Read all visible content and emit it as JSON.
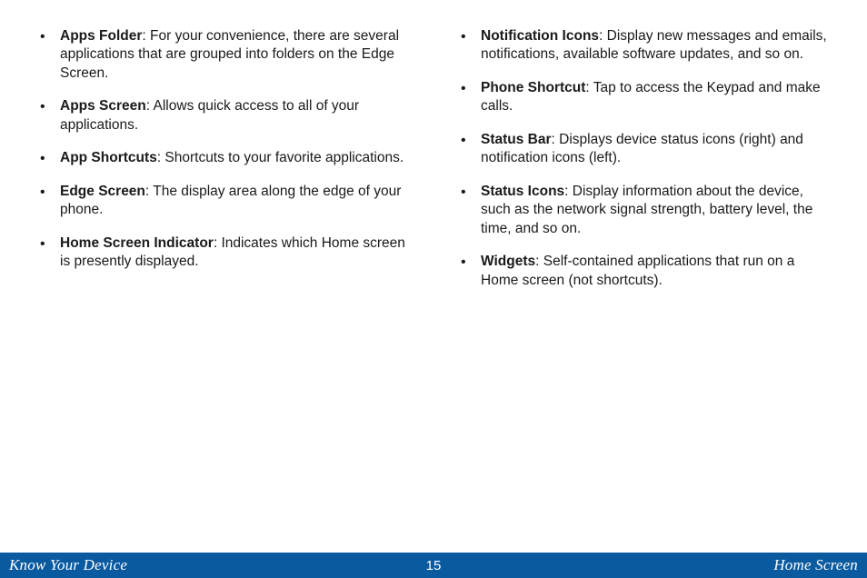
{
  "left_items": [
    {
      "term": "Apps Folder",
      "desc": ": For your convenience, there are several applications that are grouped into folders on the Edge Screen."
    },
    {
      "term": "Apps Screen",
      "desc": ": Allows quick access to all of your applications."
    },
    {
      "term": "App Shortcuts",
      "desc": ": Shortcuts to your favorite applications."
    },
    {
      "term": "Edge Screen",
      "desc": ": The display area along the edge of your phone."
    },
    {
      "term": "Home Screen Indicator",
      "desc": ": Indicates which Home screen is presently displayed."
    }
  ],
  "right_items": [
    {
      "term": "Notification Icons",
      "desc": ": Display new messages and emails, notifications, available software updates, and so on."
    },
    {
      "term": "Phone Shortcut",
      "desc": ": Tap to access the Keypad and make calls."
    },
    {
      "term": "Status Bar",
      "desc": ": Displays device status icons (right) and notification icons (left)."
    },
    {
      "term": "Status Icons",
      "desc": ": Display information about the device, such as the network signal strength, battery level, the time, and so on."
    },
    {
      "term": "Widgets",
      "desc": ": Self-contained applications that run on a Home screen (not shortcuts)."
    }
  ],
  "footer": {
    "left": "Know Your Device",
    "center": "15",
    "right": "Home Screen"
  }
}
